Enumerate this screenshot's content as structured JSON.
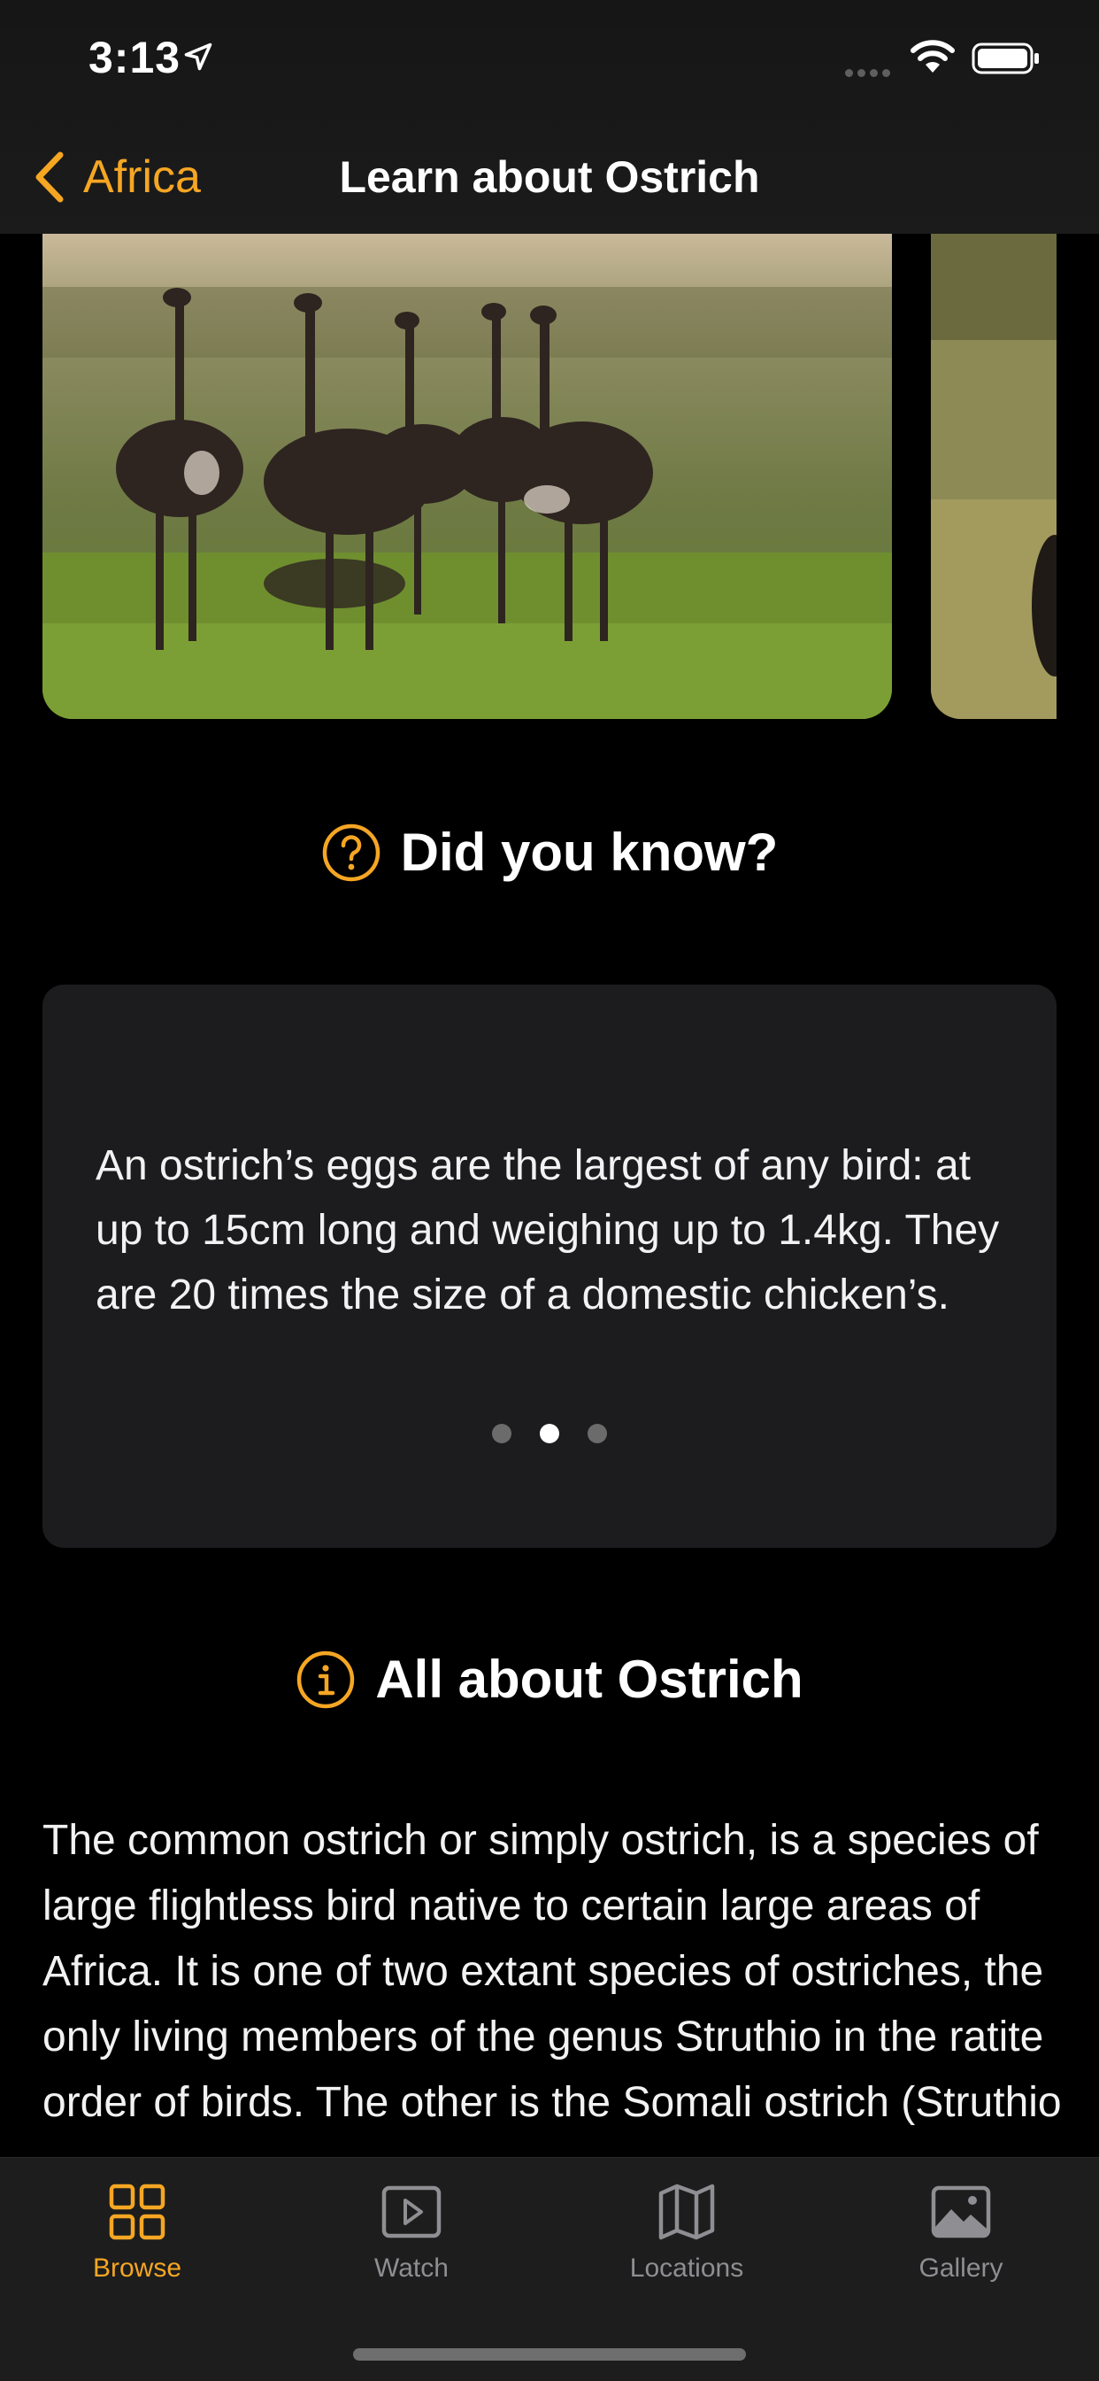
{
  "status": {
    "time": "3:13"
  },
  "nav": {
    "back_label": "Africa",
    "title": "Learn about Ostrich"
  },
  "did_you_know": {
    "title": "Did you know?",
    "fact": "An ostrich’s eggs are the largest of any bird: at up to 15cm long and weighing up to 1.4kg. They are 20 times the size of a domestic chicken’s.",
    "page_count": 3,
    "current_page": 2
  },
  "about": {
    "title": "All about Ostrich",
    "text": "The common ostrich or simply ostrich, is a species of large flightless bird native to certain large areas of Africa. It is one of two extant species of ostriches, the only living members of the genus Struthio in the ratite order of birds. The other is the Somali ostrich (Struthio"
  },
  "tabs": [
    {
      "label": "Browse",
      "icon": "grid-icon",
      "active": true
    },
    {
      "label": "Watch",
      "icon": "play-icon",
      "active": false
    },
    {
      "label": "Locations",
      "icon": "map-icon",
      "active": false
    },
    {
      "label": "Gallery",
      "icon": "photo-icon",
      "active": false
    }
  ],
  "colors": {
    "accent": "#f5a623",
    "card": "#1c1c1e",
    "tabbar": "#1d1d1d"
  }
}
